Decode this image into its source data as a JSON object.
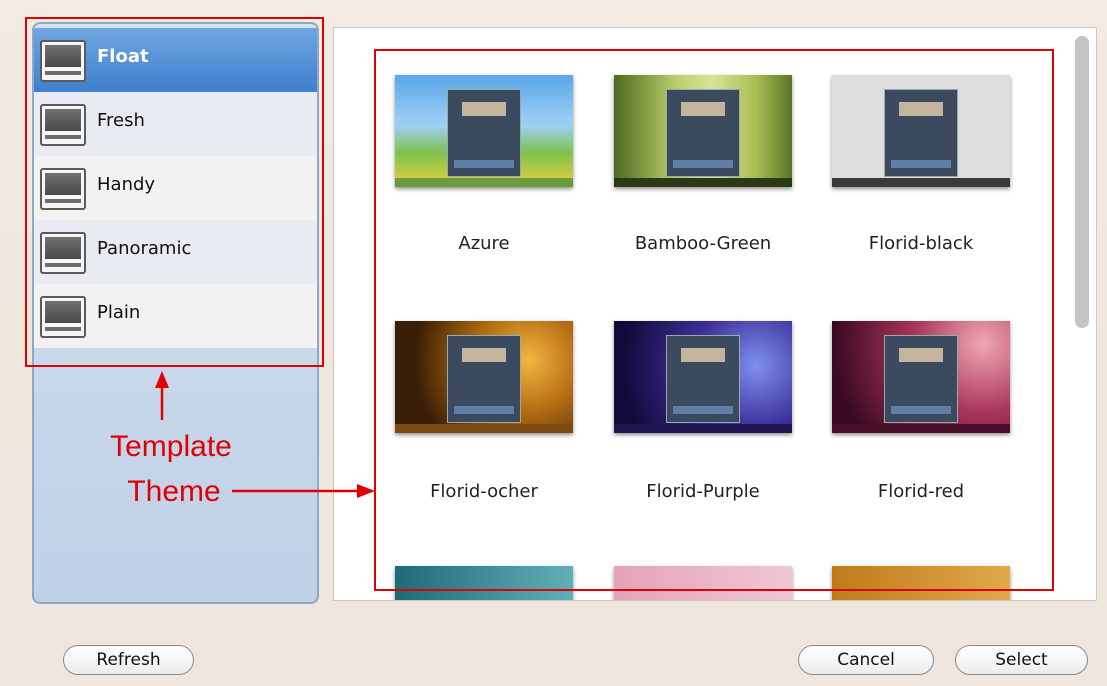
{
  "sidebar": {
    "items": [
      {
        "label": "Float",
        "selected": true,
        "icon": "template-icon"
      },
      {
        "label": "Fresh",
        "selected": false,
        "icon": "template-icon"
      },
      {
        "label": "Handy",
        "selected": false,
        "icon": "template-icon"
      },
      {
        "label": "Panoramic",
        "selected": false,
        "icon": "template-icon"
      },
      {
        "label": "Plain",
        "selected": false,
        "icon": "template-icon"
      }
    ]
  },
  "themes": [
    {
      "label": "Azure"
    },
    {
      "label": "Bamboo-Green"
    },
    {
      "label": "Florid-black"
    },
    {
      "label": "Florid-ocher"
    },
    {
      "label": "Florid-Purple"
    },
    {
      "label": "Florid-red"
    }
  ],
  "annotations": {
    "template_line1": "Template",
    "template_line2": "Theme",
    "color": "#e00000"
  },
  "buttons": {
    "refresh": "Refresh",
    "cancel": "Cancel",
    "select": "Select"
  },
  "colors": {
    "selection_blue": "#3f7fce",
    "annotation_red": "#e00000"
  }
}
